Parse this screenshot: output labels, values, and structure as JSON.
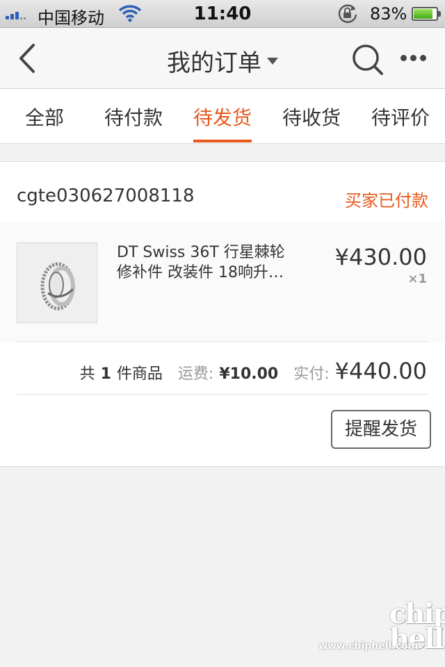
{
  "status_bar": {
    "carrier": "中国移动",
    "time": "11:40",
    "battery": "83%",
    "battery_level": 0.83
  },
  "nav": {
    "title": "我的订单",
    "back_icon": "chevron-left-icon",
    "search_icon": "search-icon",
    "more_icon": "more-dots-icon"
  },
  "tabs": [
    {
      "label": "全部"
    },
    {
      "label": "待付款"
    },
    {
      "label": "待发货",
      "active": true
    },
    {
      "label": "待收货"
    },
    {
      "label": "待评价"
    }
  ],
  "order": {
    "order_number": "cgte030627008118",
    "status": "买家已付款",
    "product": {
      "title_line1": "DT Swiss 36T  行星棘轮",
      "title_line2": "修补件 改装件 18响升…",
      "price": "¥430.00",
      "quantity": "×1"
    },
    "summary": {
      "count_prefix": "共",
      "count": "1",
      "count_suffix": "件商品",
      "shipping_label": "运费:",
      "shipping_value": "¥10.00",
      "paid_label": "实付:",
      "paid_value": "¥440.00"
    },
    "remind_button": "提醒发货"
  },
  "watermark": {
    "logo_line1": "chip",
    "logo_line2": "hell",
    "url": "www.chiphell.com"
  },
  "colors": {
    "accent": "#e8591b",
    "text": "#333333",
    "muted": "#999999"
  }
}
